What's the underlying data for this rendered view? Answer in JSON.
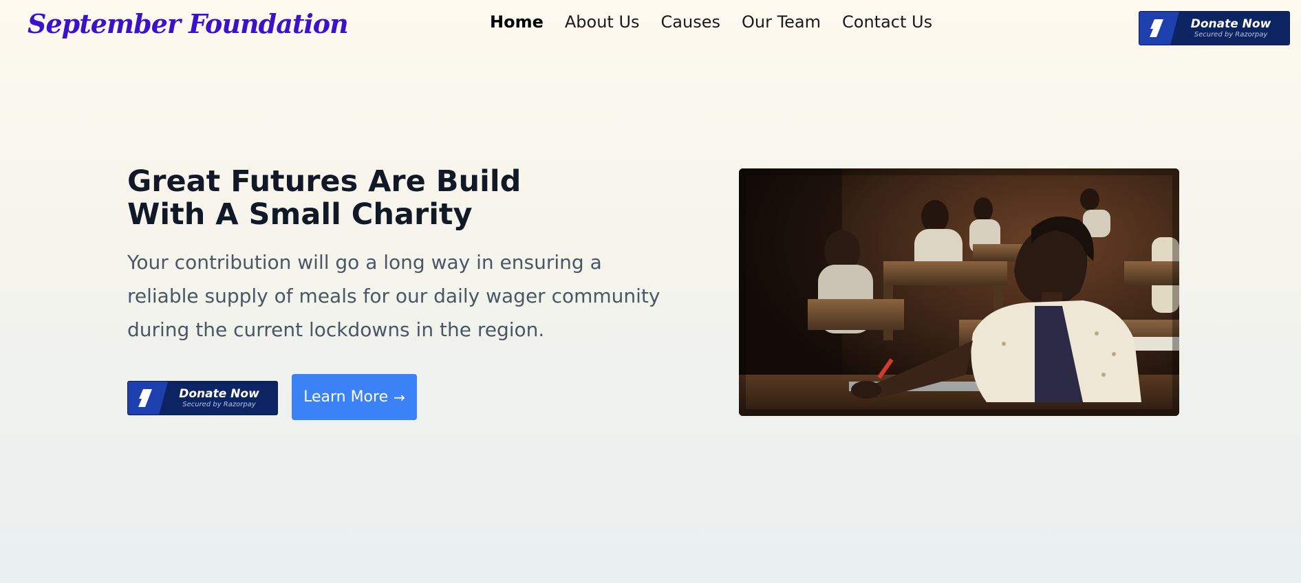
{
  "brand": {
    "name": "September Foundation"
  },
  "nav": {
    "items": [
      {
        "label": "Home",
        "active": true
      },
      {
        "label": "About Us",
        "active": false
      },
      {
        "label": "Causes",
        "active": false
      },
      {
        "label": "Our Team",
        "active": false
      },
      {
        "label": "Contact Us",
        "active": false
      }
    ]
  },
  "donate_button": {
    "label": "Donate Now",
    "sublabel": "Secured by Razorpay",
    "icon": "razorpay-logo-icon",
    "bg_color": "#0c2461",
    "accent_color": "#1e3fae"
  },
  "hero": {
    "title_line1": "Great Futures Are Build",
    "title_line2": "With A Small Charity",
    "description": "Your contribution will go a long way in ensuring a reliable supply of meals for our daily wager community during the current lockdowns in the region.",
    "learn_more_label": "Learn More",
    "learn_more_icon": "arrow-right-icon",
    "learn_more_color": "#3b82f6"
  },
  "colors": {
    "brand": "#3b12c9"
  }
}
